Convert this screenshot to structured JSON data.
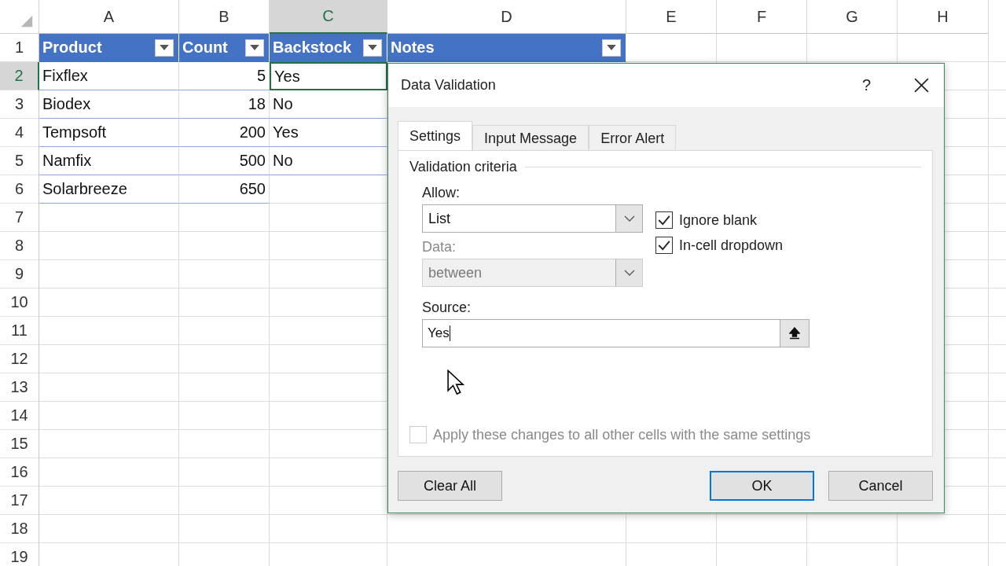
{
  "column_headers": [
    {
      "label": "A",
      "selected": false
    },
    {
      "label": "B",
      "selected": false
    },
    {
      "label": "C",
      "selected": true
    },
    {
      "label": "D",
      "selected": false
    },
    {
      "label": "E",
      "selected": false
    },
    {
      "label": "F",
      "selected": false
    },
    {
      "label": "G",
      "selected": false
    },
    {
      "label": "H",
      "selected": false
    }
  ],
  "row_headers": [
    {
      "label": "1",
      "selected": false
    },
    {
      "label": "2",
      "selected": true
    },
    {
      "label": "3",
      "selected": false
    },
    {
      "label": "4",
      "selected": false
    },
    {
      "label": "5",
      "selected": false
    },
    {
      "label": "6",
      "selected": false
    },
    {
      "label": "7",
      "selected": false
    },
    {
      "label": "8",
      "selected": false
    },
    {
      "label": "9",
      "selected": false
    },
    {
      "label": "10",
      "selected": false
    },
    {
      "label": "11",
      "selected": false
    },
    {
      "label": "12",
      "selected": false
    },
    {
      "label": "13",
      "selected": false
    },
    {
      "label": "14",
      "selected": false
    },
    {
      "label": "15",
      "selected": false
    },
    {
      "label": "16",
      "selected": false
    },
    {
      "label": "17",
      "selected": false
    },
    {
      "label": "18",
      "selected": false
    },
    {
      "label": "19",
      "selected": false
    }
  ],
  "table": {
    "headers": [
      "Product",
      "Count",
      "Backstock",
      "Notes"
    ],
    "rows": [
      {
        "cells": [
          {
            "text": "Fixflex",
            "kind": "text",
            "selected": false
          },
          {
            "text": "5",
            "kind": "number",
            "selected": false
          },
          {
            "text": "Yes",
            "kind": "text",
            "selected": true
          }
        ]
      },
      {
        "cells": [
          {
            "text": "Biodex",
            "kind": "text",
            "selected": false
          },
          {
            "text": "18",
            "kind": "number",
            "selected": false
          },
          {
            "text": "No",
            "kind": "text",
            "selected": false
          }
        ]
      },
      {
        "cells": [
          {
            "text": "Tempsoft",
            "kind": "text",
            "selected": false
          },
          {
            "text": "200",
            "kind": "number",
            "selected": false
          },
          {
            "text": "Yes",
            "kind": "text",
            "selected": false
          }
        ]
      },
      {
        "cells": [
          {
            "text": "Namfix",
            "kind": "text",
            "selected": false
          },
          {
            "text": "500",
            "kind": "number",
            "selected": false
          },
          {
            "text": "No",
            "kind": "text",
            "selected": false
          }
        ]
      },
      {
        "cells": [
          {
            "text": "Solarbreeze",
            "kind": "text",
            "selected": false
          },
          {
            "text": "650",
            "kind": "number",
            "selected": false
          }
        ]
      }
    ]
  },
  "dialog": {
    "title": "Data Validation",
    "help": "?",
    "tabs": [
      {
        "label": "Settings",
        "selected": true
      },
      {
        "label": "Input Message",
        "selected": false
      },
      {
        "label": "Error Alert",
        "selected": false
      }
    ],
    "section": "Validation criteria",
    "allow": {
      "label": "Allow:",
      "value": "List",
      "disabled": false
    },
    "data": {
      "label": "Data:",
      "value": "between",
      "disabled": true
    },
    "checkboxes": [
      {
        "label": "Ignore blank",
        "checked": true
      },
      {
        "label": "In-cell dropdown",
        "checked": true
      }
    ],
    "source": {
      "label": "Source:",
      "value": "Yes"
    },
    "apply": {
      "label": "Apply these changes to all other cells with the same settings",
      "checked": false,
      "disabled": true
    },
    "buttons": [
      {
        "label": "Clear All",
        "default": false
      },
      {
        "label": "OK",
        "default": true
      },
      {
        "label": "Cancel",
        "default": false
      }
    ]
  }
}
